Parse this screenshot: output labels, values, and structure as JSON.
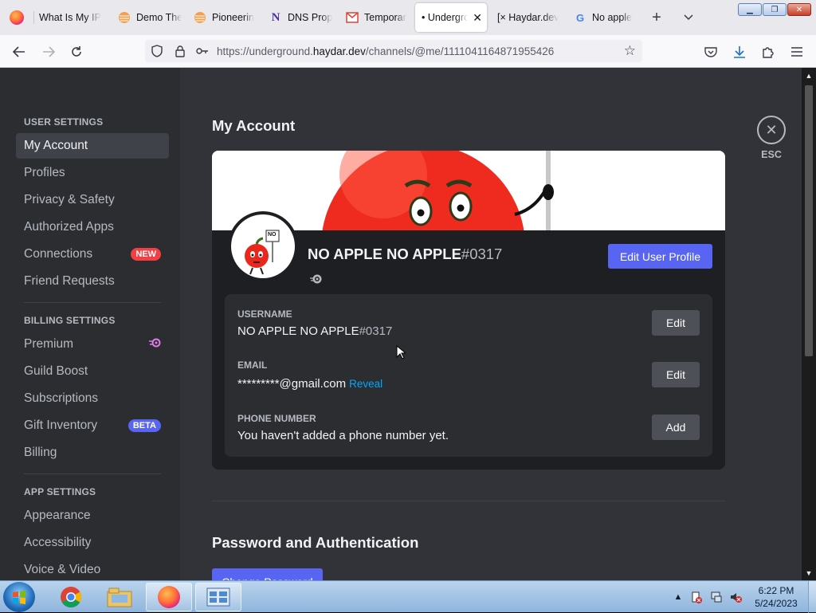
{
  "browser": {
    "tabs": [
      {
        "label": "What Is My IP",
        "icon": "firefox-icon"
      },
      {
        "label": "Demo The",
        "icon": "orange-sphere-icon"
      },
      {
        "label": "Pioneerin",
        "icon": "orange-sphere-icon"
      },
      {
        "label": "DNS Prop",
        "icon": "n-logo-icon"
      },
      {
        "label": "Temporar",
        "icon": "mail-icon"
      },
      {
        "label": "• Undergro",
        "icon": "",
        "active": true
      },
      {
        "label": "[× Haydar.dev",
        "icon": ""
      },
      {
        "label": "No apple",
        "icon": "google-icon"
      }
    ],
    "url": {
      "prefix": "https://underground.",
      "host": "haydar.dev",
      "path": "/channels/@me/1111041164871955426"
    }
  },
  "sidebar": {
    "user_settings_header": "USER SETTINGS",
    "user_items": [
      "My Account",
      "Profiles",
      "Privacy & Safety",
      "Authorized Apps",
      "Connections",
      "Friend Requests"
    ],
    "connections_badge": "NEW",
    "billing_settings_header": "BILLING SETTINGS",
    "billing_items": [
      "Premium",
      "Guild Boost",
      "Subscriptions",
      "Gift Inventory",
      "Billing"
    ],
    "gift_badge": "BETA",
    "app_settings_header": "APP SETTINGS",
    "app_items": [
      "Appearance",
      "Accessibility",
      "Voice & Video"
    ]
  },
  "account": {
    "title": "My Account",
    "avatar_sign": "NO",
    "display_name": "NO APPLE NO APPLE",
    "discriminator": "#0317",
    "edit_profile_label": "Edit User Profile",
    "fields": {
      "username_label": "USERNAME",
      "username_value": "NO APPLE NO APPLE",
      "username_disc": "#0317",
      "email_label": "EMAIL",
      "email_value": "*********@gmail.com",
      "reveal_label": "Reveal",
      "phone_label": "PHONE NUMBER",
      "phone_value": "You haven't added a phone number yet."
    },
    "edit_label": "Edit",
    "add_label": "Add",
    "password_title": "Password and Authentication",
    "change_password_label": "Change Password"
  },
  "esc_label": "ESC",
  "taskbar": {
    "time": "6:22 PM",
    "date": "5/24/2023"
  },
  "colors": {
    "accent": "#5865f2",
    "link": "#00a8fc",
    "badge_new": "#f23f43"
  }
}
